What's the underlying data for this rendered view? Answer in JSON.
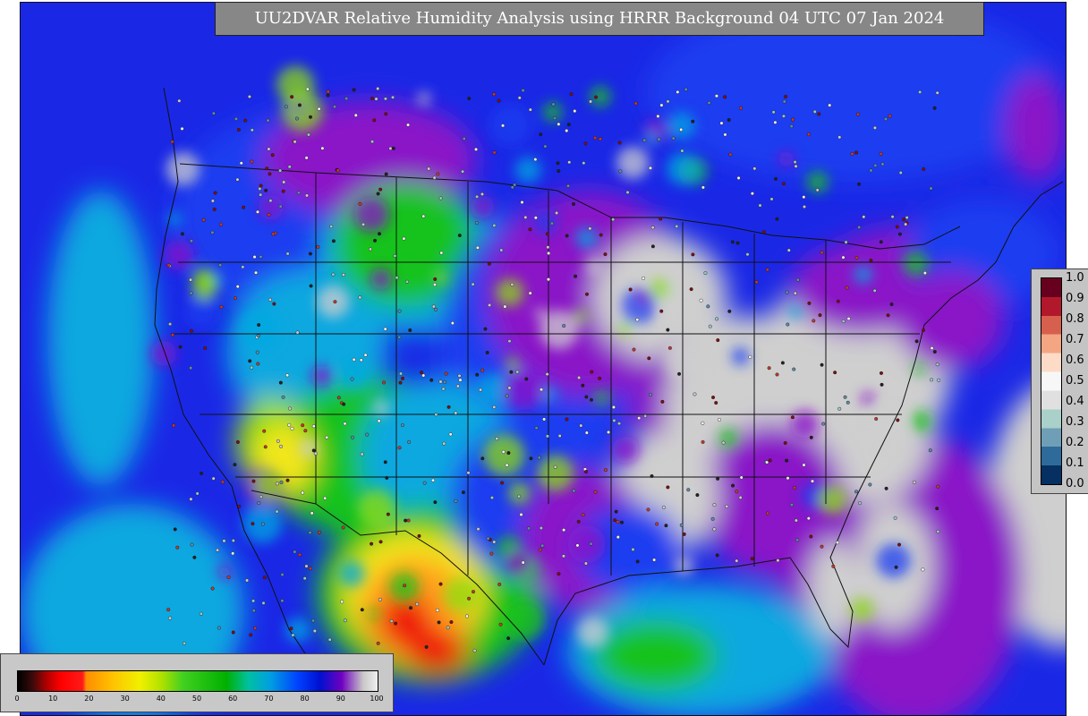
{
  "title": "UU2DVAR Relative Humidity Analysis using HRRR Background 04 UTC 07 Jan 2024",
  "map": {
    "field": "relative humidity",
    "background_colors": {
      "ocean_moist": "#1a28e6",
      "ocean_saturated": "#cfcfcf",
      "purple": "#8a12c8",
      "blue": "#1e3cf0",
      "cyan": "#08a8e0",
      "green": "#19c21a",
      "lime": "#8edb10",
      "yellow": "#f2e61c",
      "orange": "#ffa01a",
      "red": "#ee1010"
    },
    "observation_colors": [
      "#f0f0f0",
      "#c8c8c8",
      "#9ac8c0",
      "#5d8aa8",
      "#c0392b",
      "#7b1010",
      "#222222"
    ]
  },
  "rh_colorbar": {
    "ticks": [
      "0",
      "10",
      "20",
      "30",
      "40",
      "50",
      "60",
      "70",
      "80",
      "90",
      "100"
    ],
    "stops": [
      {
        "v": 0,
        "c": "#000000"
      },
      {
        "v": 4,
        "c": "#3a0a0a"
      },
      {
        "v": 8,
        "c": "#b00000"
      },
      {
        "v": 12,
        "c": "#ff0000"
      },
      {
        "v": 18,
        "c": "#ff1a1a"
      },
      {
        "v": 19,
        "c": "#ff8c00"
      },
      {
        "v": 26,
        "c": "#ffc000"
      },
      {
        "v": 34,
        "c": "#f0f000"
      },
      {
        "v": 40,
        "c": "#b0e000"
      },
      {
        "v": 46,
        "c": "#40d020"
      },
      {
        "v": 58,
        "c": "#00b000"
      },
      {
        "v": 64,
        "c": "#00c0a0"
      },
      {
        "v": 70,
        "c": "#00a0e0"
      },
      {
        "v": 78,
        "c": "#0040ff"
      },
      {
        "v": 84,
        "c": "#0010d0"
      },
      {
        "v": 90,
        "c": "#7000c0"
      },
      {
        "v": 96,
        "c": "#c8c8c8"
      },
      {
        "v": 100,
        "c": "#f0f0f0"
      }
    ]
  },
  "ob_colorbar": {
    "ticks": [
      "1.0",
      "0.9",
      "0.8",
      "0.7",
      "0.6",
      "0.5",
      "0.4",
      "0.3",
      "0.2",
      "0.1",
      "0.0"
    ],
    "colors": [
      "#67001f",
      "#b2182b",
      "#d6604d",
      "#f4a582",
      "#fddbc7",
      "#f7f7f7",
      "#e0e0e0",
      "#a9d0c9",
      "#6f9fb6",
      "#2f6b9a",
      "#053061"
    ]
  }
}
